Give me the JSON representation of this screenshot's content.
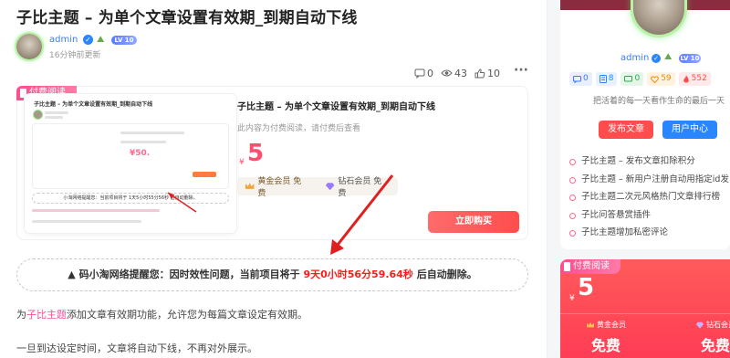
{
  "article": {
    "title": "子比主题 – 为单个文章设置有效期_到期自动下线",
    "author": {
      "name": "admin",
      "level_badge": "LV 10",
      "time": "16分钟前更新"
    },
    "stats": {
      "comments": "0",
      "views": "43",
      "likes": "10"
    }
  },
  "pay_box": {
    "tag": "付费阅读",
    "product_title": "子比主题 – 为单个文章设置有效期_到期自动下线",
    "description": "此内容为付费阅读，请付费后查看",
    "price_symbol": "¥",
    "price": "5",
    "vip_gold": "黄金会员 免费",
    "vip_diamond": "钻石会员 免费",
    "buy_label": "立即购买",
    "preview": {
      "title": "子比主题 – 为单个文章设置有效期_到期自动下线",
      "price": "¥50.",
      "notice": "小淘网络提醒您：当前项目将于 1天5小时55分56秒 后自动删除。"
    }
  },
  "notice": {
    "prefix": "▲ 码小淘网络提醒您：因时效性问题，当前项目将于",
    "countdown": "9天0小时56分59.64秒",
    "suffix": "后自动删除。"
  },
  "content": {
    "para1_link": "子比主题",
    "para1_text": "添加文章有效期功能，允许您为每篇文章设定有效期。",
    "para2": "一旦到达设定时间，文章将自动下线，不再对外展示。"
  },
  "sidebar": {
    "author": {
      "name": "admin",
      "level_badge": "LV 10"
    },
    "stats": [
      "0",
      "8",
      "0",
      "59",
      "552"
    ],
    "motto": "把活着的每一天看作生命的最后一天",
    "publish_btn": "发布文章",
    "user_center_btn": "用户中心",
    "posts": [
      "子比主题 – 发布文章扣除积分",
      "子比主题 – 新用户注册自动用指定id发",
      "子比主题二次元风格热门文章排行榜",
      "子比问答悬赏插件",
      "子比主题增加私密评论"
    ],
    "pay_card": {
      "tag": "付费阅读",
      "price_symbol": "¥",
      "price": "5",
      "gold_label": "黄金会员",
      "gold_value": "免费",
      "diamond_label": "钻石会员",
      "diamond_value": "免费"
    }
  },
  "colors": {
    "accent_red": "#ff4d4d",
    "link_pink": "#ff4d9d",
    "primary_blue": "#2a86ff",
    "countdown_red": "#ff1a1a"
  }
}
